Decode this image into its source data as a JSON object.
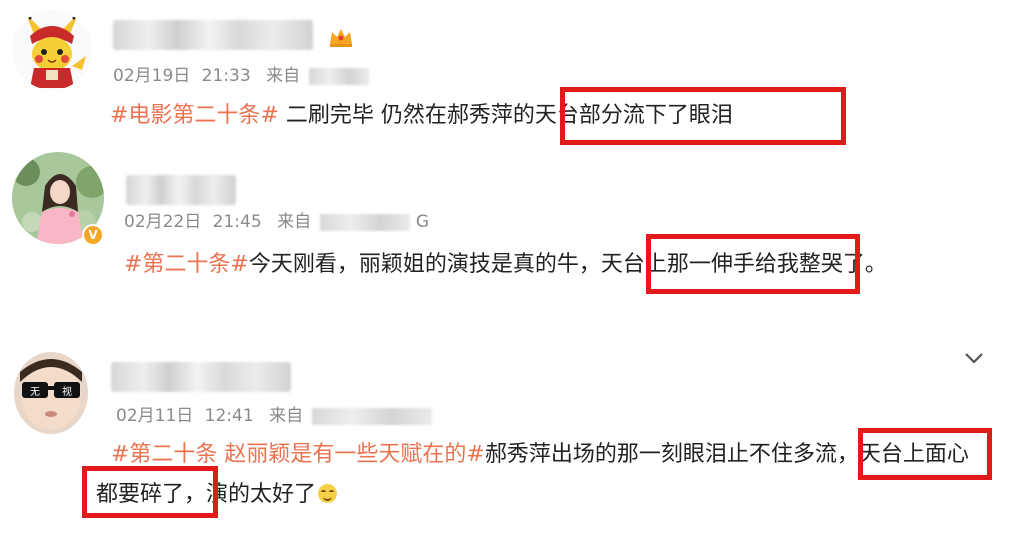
{
  "posts": [
    {
      "username_visible_fragment": "",
      "meta": {
        "date": "02月19日",
        "time": "21:33",
        "source_label": "来自"
      },
      "content": {
        "hashtag": "#电影第二十条#",
        "text_before_box": " 二刷完毕 仍然在郝秀萍的",
        "boxed_text": "天台部分流下了眼泪",
        "text_after": ""
      }
    },
    {
      "username_visible_fragment": "",
      "meta": {
        "date": "02月22日",
        "time": "21:45",
        "source_label": "来自",
        "source_tail": "G"
      },
      "content": {
        "hashtag": "#第二十条#",
        "text_before_box": "今天刚看，丽颖姐的演技是真的牛，",
        "boxed_text": "天台上那一伸手",
        "text_after": "给我整哭了。"
      }
    },
    {
      "username_visible_fragment": "",
      "meta": {
        "date": "02月11日",
        "time": "12:41",
        "source_label": "来自"
      },
      "content": {
        "hashtag": "#第二十条 赵丽颖是有一些天赋在的#",
        "text_before_box": "郝秀萍出场的那一刻眼泪止不住多流，",
        "boxed_text_line1": "天台上面心",
        "boxed_text_line2": "都要碎了，",
        "text_after": "演的太好了",
        "emoji": "relieved-face"
      }
    }
  ],
  "colors": {
    "hashtag": "#eb7350",
    "highlight_box": "#e21a1a",
    "meta_text": "#8a8a8a",
    "body_text": "#222222"
  },
  "icons": {
    "crown": "crown-icon",
    "verified": "verified-badge-icon",
    "expand": "chevron-down-icon"
  }
}
